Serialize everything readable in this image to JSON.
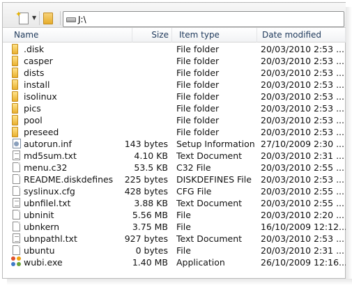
{
  "window": {
    "title": "J:\\"
  },
  "toolbar": {
    "new_button_icon": "new-document-icon",
    "folder_button_icon": "folder-icon",
    "address_path": "J:\\",
    "address_icon": "drive-icon"
  },
  "columns": {
    "name": "Name",
    "size": "Size",
    "type": "Item type",
    "date": "Date modified"
  },
  "files": [
    {
      "name": ".disk",
      "size": "",
      "type": "File folder",
      "date": "20/03/2010 2:53 ...",
      "icon": "folder-icon"
    },
    {
      "name": "casper",
      "size": "",
      "type": "File folder",
      "date": "20/03/2010 2:53 ...",
      "icon": "folder-icon"
    },
    {
      "name": "dists",
      "size": "",
      "type": "File folder",
      "date": "20/03/2010 2:53 ...",
      "icon": "folder-icon"
    },
    {
      "name": "install",
      "size": "",
      "type": "File folder",
      "date": "20/03/2010 2:53 ...",
      "icon": "folder-icon"
    },
    {
      "name": "isolinux",
      "size": "",
      "type": "File folder",
      "date": "20/03/2010 2:53 ...",
      "icon": "folder-icon"
    },
    {
      "name": "pics",
      "size": "",
      "type": "File folder",
      "date": "20/03/2010 2:53 ...",
      "icon": "folder-icon"
    },
    {
      "name": "pool",
      "size": "",
      "type": "File folder",
      "date": "20/03/2010 2:53 ...",
      "icon": "folder-icon"
    },
    {
      "name": "preseed",
      "size": "",
      "type": "File folder",
      "date": "20/03/2010 2:53 ...",
      "icon": "folder-icon"
    },
    {
      "name": "autorun.inf",
      "size": "143 bytes",
      "type": "Setup Information",
      "date": "27/10/2009 2:30 ...",
      "icon": "setup-information-icon"
    },
    {
      "name": "md5sum.txt",
      "size": "4.10 KB",
      "type": "Text Document",
      "date": "20/03/2010 2:31 ...",
      "icon": "text-document-icon"
    },
    {
      "name": "menu.c32",
      "size": "53.5 KB",
      "type": "C32 File",
      "date": "20/03/2010 2:55 ...",
      "icon": "file-icon"
    },
    {
      "name": "README.diskdefines",
      "size": "225 bytes",
      "type": "DISKDEFINES File",
      "date": "20/03/2010 2:53 ...",
      "icon": "file-icon"
    },
    {
      "name": "syslinux.cfg",
      "size": "428 bytes",
      "type": "CFG File",
      "date": "20/03/2010 2:55 ...",
      "icon": "file-icon"
    },
    {
      "name": "ubnfilel.txt",
      "size": "3.88 KB",
      "type": "Text Document",
      "date": "20/03/2010 2:55 ...",
      "icon": "text-document-icon"
    },
    {
      "name": "ubninit",
      "size": "5.56 MB",
      "type": "File",
      "date": "20/03/2010 2:20 ...",
      "icon": "file-icon"
    },
    {
      "name": "ubnkern",
      "size": "3.75 MB",
      "type": "File",
      "date": "16/10/2009 12:12...",
      "icon": "file-icon"
    },
    {
      "name": "ubnpathl.txt",
      "size": "927 bytes",
      "type": "Text Document",
      "date": "20/03/2010 2:53 ...",
      "icon": "text-document-icon"
    },
    {
      "name": "ubuntu",
      "size": "0 bytes",
      "type": "File",
      "date": "20/03/2010 2:31 ...",
      "icon": "file-icon"
    },
    {
      "name": "wubi.exe",
      "size": "1.40 MB",
      "type": "Application",
      "date": "26/10/2009 12:16...",
      "icon": "application-icon"
    }
  ]
}
